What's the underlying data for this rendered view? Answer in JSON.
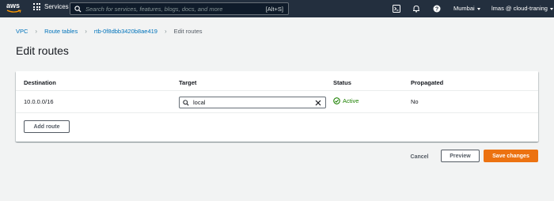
{
  "topbar": {
    "logo_text": "aws",
    "services_label": "Services",
    "search_placeholder": "Search for services, features, blogs, docs, and more",
    "search_shortcut": "[Alt+S]",
    "icons": [
      "grid-icon",
      "search-icon",
      "cloudshell-icon",
      "bell-icon",
      "help-icon"
    ],
    "region": "Mumbai",
    "account": "lmas @ cloud-traning"
  },
  "breadcrumb": {
    "items": [
      "VPC",
      "Route tables",
      "rtb-0f8dbb3420b8ae419"
    ],
    "current": "Edit routes"
  },
  "page_title": "Edit routes",
  "routes_table": {
    "columns": [
      "Destination",
      "Target",
      "Status",
      "Propagated"
    ],
    "rows": [
      {
        "destination": "10.0.0.0/16",
        "target": "local",
        "status": "Active",
        "propagated": "No"
      }
    ],
    "add_route_label": "Add route"
  },
  "actions": {
    "cancel": "Cancel",
    "preview": "Preview",
    "save": "Save changes"
  },
  "colors": {
    "topbar_bg": "#232f3e",
    "link": "#0073bb",
    "status_active": "#1d8102",
    "primary_button": "#ec7211"
  }
}
